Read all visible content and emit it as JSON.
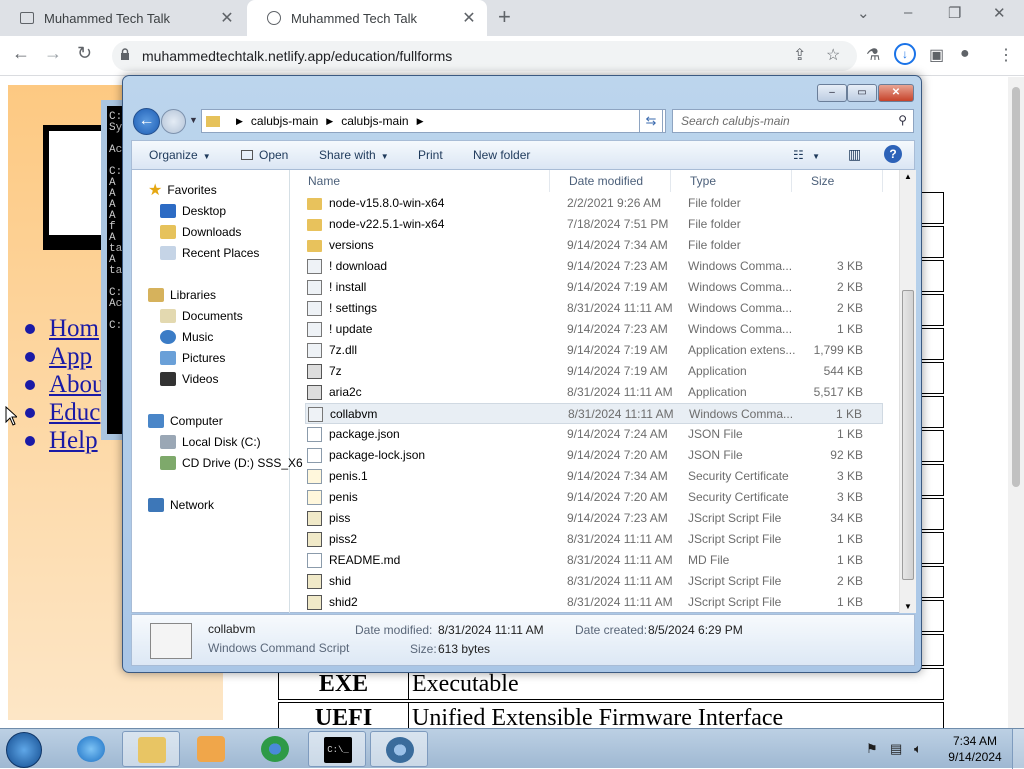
{
  "browser": {
    "tabs": [
      {
        "title": "Muhammed Tech Talk",
        "close": "✕"
      },
      {
        "title": "Muhammed Tech Talk",
        "close": "✕"
      }
    ],
    "new_tab": "+",
    "window_controls": {
      "dropdown": "⌄",
      "minimize": "–",
      "restore": "❐",
      "close": "✕"
    },
    "nav": {
      "back": "←",
      "forward": "→",
      "reload": "↻"
    },
    "url": "muhammedtechtalk.netlify.app/education/fullforms",
    "toolbar_icons": [
      "share-icon",
      "bookmark-star-icon",
      "extension-icon",
      "download-icon",
      "sidepanel-icon",
      "profile-icon",
      "menu-icon"
    ]
  },
  "webpage": {
    "nav_links": [
      "Hom",
      "App",
      "Abou",
      "Educ",
      "Help"
    ],
    "table_rows": [
      {
        "abbr": "EXE",
        "full": "Executable"
      },
      {
        "abbr": "UEFI",
        "full": "Unified Extensible Firmware Interface"
      }
    ]
  },
  "console": {
    "lines": [
      "C:",
      "Sy",
      "",
      "Ac",
      "",
      "C:",
      "A",
      "A",
      "A",
      "A",
      "f",
      "A",
      "ta",
      "A",
      "ta",
      "",
      "C:",
      "Ac",
      "",
      "C:"
    ]
  },
  "explorer": {
    "title_buttons": {
      "minimize": "–",
      "maximize": "▭",
      "close": "✕"
    },
    "address": [
      "calubjs-main",
      "calubjs-main"
    ],
    "search_placeholder": "Search calubjs-main",
    "commands": {
      "organize": "Organize",
      "open": "Open",
      "share": "Share with",
      "print": "Print",
      "new_folder": "New folder"
    },
    "nav_pane": {
      "favorites": "Favorites",
      "favorite_items": [
        "Desktop",
        "Downloads",
        "Recent Places"
      ],
      "libraries": "Libraries",
      "library_items": [
        "Documents",
        "Music",
        "Pictures",
        "Videos"
      ],
      "computer": "Computer",
      "computer_items": [
        "Local Disk (C:)",
        "CD Drive (D:) SSS_X6"
      ],
      "network": "Network"
    },
    "columns": {
      "name": "Name",
      "date": "Date modified",
      "type": "Type",
      "size": "Size"
    },
    "files": [
      {
        "name": "node-v15.8.0-win-x64",
        "date": "2/2/2021 9:26 AM",
        "type": "File folder",
        "size": "",
        "icon": "folder"
      },
      {
        "name": "node-v22.5.1-win-x64",
        "date": "7/18/2024 7:51 PM",
        "type": "File folder",
        "size": "",
        "icon": "folder"
      },
      {
        "name": "versions",
        "date": "9/14/2024 7:34 AM",
        "type": "File folder",
        "size": "",
        "icon": "folder"
      },
      {
        "name": "! download",
        "date": "9/14/2024 7:23 AM",
        "type": "Windows Comma...",
        "size": "3 KB",
        "icon": "bat"
      },
      {
        "name": "! install",
        "date": "9/14/2024 7:19 AM",
        "type": "Windows Comma...",
        "size": "2 KB",
        "icon": "bat"
      },
      {
        "name": "! settings",
        "date": "8/31/2024 11:11 AM",
        "type": "Windows Comma...",
        "size": "2 KB",
        "icon": "bat"
      },
      {
        "name": "! update",
        "date": "9/14/2024 7:23 AM",
        "type": "Windows Comma...",
        "size": "1 KB",
        "icon": "bat"
      },
      {
        "name": "7z.dll",
        "date": "9/14/2024 7:19 AM",
        "type": "Application extens...",
        "size": "1,799 KB",
        "icon": "bat"
      },
      {
        "name": "7z",
        "date": "9/14/2024 7:19 AM",
        "type": "Application",
        "size": "544 KB",
        "icon": "app"
      },
      {
        "name": "aria2c",
        "date": "8/31/2024 11:11 AM",
        "type": "Application",
        "size": "5,517 KB",
        "icon": "app"
      },
      {
        "name": "collabvm",
        "date": "8/31/2024 11:11 AM",
        "type": "Windows Comma...",
        "size": "1 KB",
        "icon": "bat"
      },
      {
        "name": "package.json",
        "date": "9/14/2024 7:24 AM",
        "type": "JSON File",
        "size": "1 KB",
        "icon": "doc"
      },
      {
        "name": "package-lock.json",
        "date": "9/14/2024 7:20 AM",
        "type": "JSON File",
        "size": "92 KB",
        "icon": "doc"
      },
      {
        "name": "penis.1",
        "date": "9/14/2024 7:34 AM",
        "type": "Security Certificate",
        "size": "3 KB",
        "icon": "cert"
      },
      {
        "name": "penis",
        "date": "9/14/2024 7:20 AM",
        "type": "Security Certificate",
        "size": "3 KB",
        "icon": "cert"
      },
      {
        "name": "piss",
        "date": "9/14/2024 7:23 AM",
        "type": "JScript Script File",
        "size": "34 KB",
        "icon": "js"
      },
      {
        "name": "piss2",
        "date": "8/31/2024 11:11 AM",
        "type": "JScript Script File",
        "size": "1 KB",
        "icon": "js"
      },
      {
        "name": "README.md",
        "date": "8/31/2024 11:11 AM",
        "type": "MD File",
        "size": "1 KB",
        "icon": "doc"
      },
      {
        "name": "shid",
        "date": "8/31/2024 11:11 AM",
        "type": "JScript Script File",
        "size": "2 KB",
        "icon": "js"
      },
      {
        "name": "shid2",
        "date": "8/31/2024 11:11 AM",
        "type": "JScript Script File",
        "size": "1 KB",
        "icon": "js"
      }
    ],
    "selected_file": "collabvm",
    "details": {
      "name": "collabvm",
      "type": "Windows Command Script",
      "modified_label": "Date modified:",
      "modified": "8/31/2024 11:11 AM",
      "created_label": "Date created:",
      "created": "8/5/2024 6:29 PM",
      "size_label": "Size:",
      "size": "613 bytes"
    }
  },
  "taskbar": {
    "time": "7:34 AM",
    "date": "9/14/2024",
    "cmd_label": "C:\\_"
  }
}
